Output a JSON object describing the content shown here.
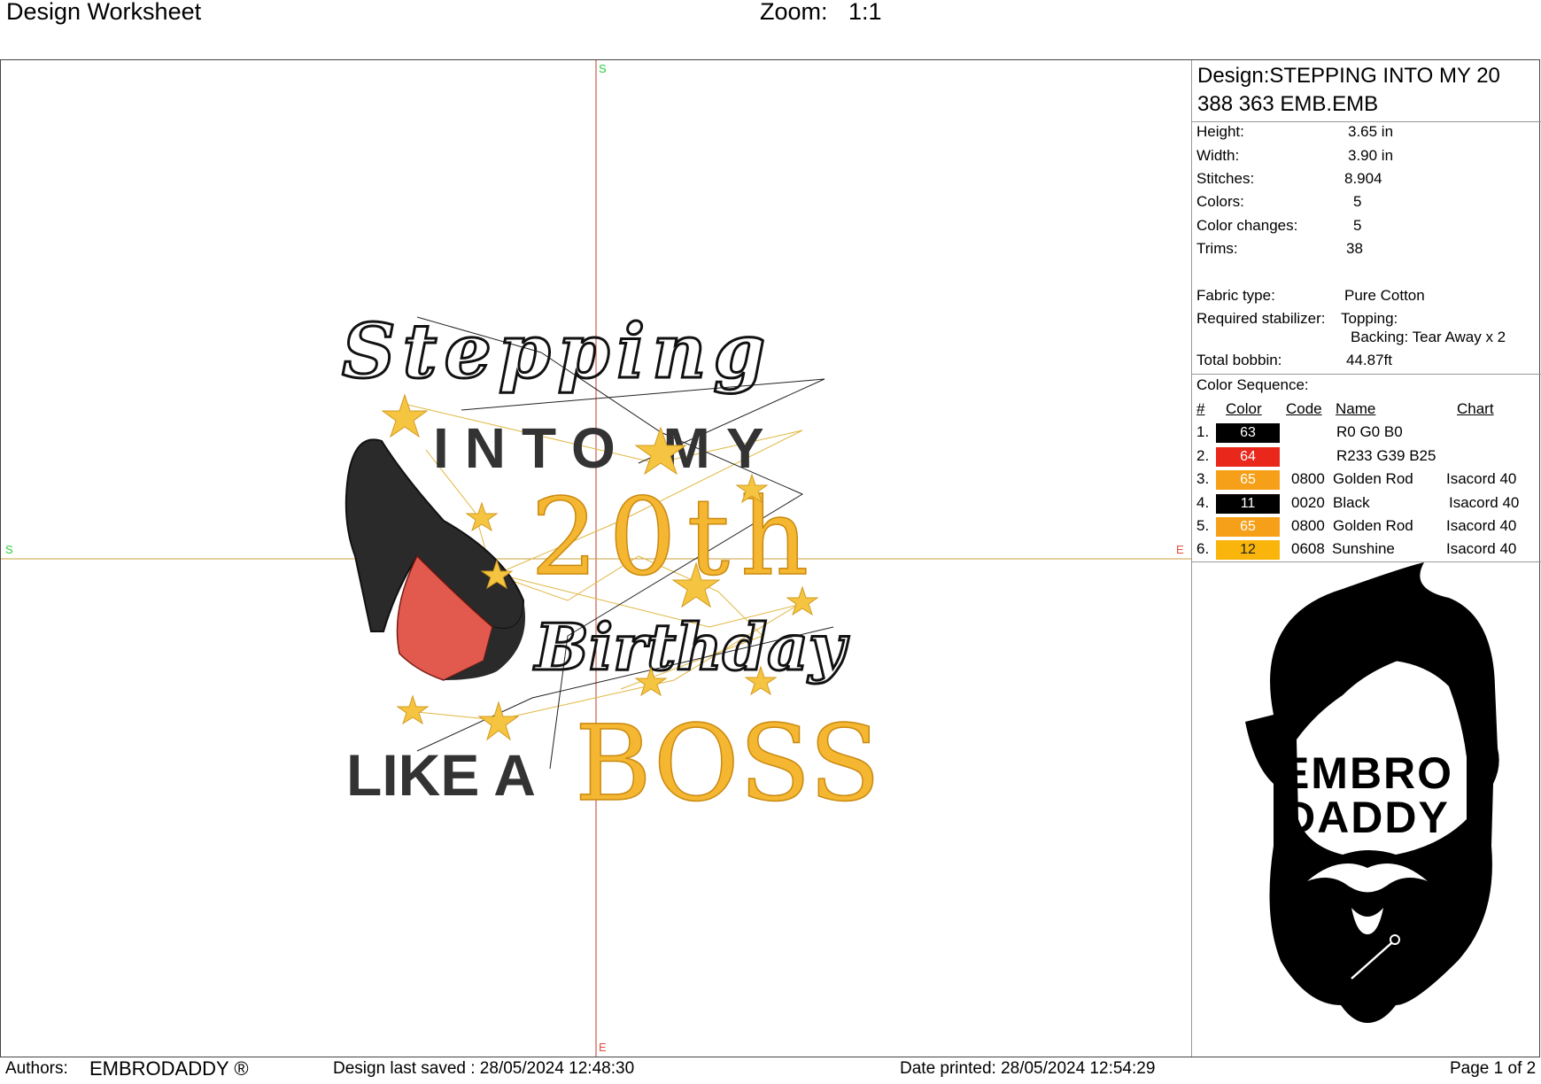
{
  "header": {
    "title": "Design Worksheet",
    "zoom_label": "Zoom:",
    "zoom_value": "1:1"
  },
  "canvas": {
    "markers": {
      "top": "S",
      "left": "S",
      "right": "E",
      "bottom": "E"
    },
    "design_text": {
      "line1": "Stepping",
      "line2": "INTO MY",
      "line3": "20th",
      "line4": "Birthday",
      "line5a": "LIKE A",
      "line5b": "BOSS"
    },
    "colors": {
      "crosshair_v": "#c0392b",
      "crosshair_h": "#c8a040",
      "gold": "#f5b731",
      "red": "#e9271b",
      "black": "#111111"
    }
  },
  "panel": {
    "design_title": "Design:STEPPING INTO MY 20 388 363 EMB.EMB",
    "stats": [
      {
        "label": "Height:",
        "value": "3.65 in"
      },
      {
        "label": "Width:",
        "value": "3.90 in"
      },
      {
        "label": "Stitches:",
        "value": "8.904"
      },
      {
        "label": "Colors:",
        "value": "5"
      },
      {
        "label": "Color changes:",
        "value": "5"
      },
      {
        "label": "Trims:",
        "value": "38"
      }
    ],
    "fabric_label": "Fabric type:",
    "fabric_value": "Pure Cotton",
    "stabilizer_label": "Required stabilizer:",
    "topping": "Topping:",
    "backing": "Backing: Tear Away x 2",
    "bobbin_label": "Total bobbin:",
    "bobbin_value": "44.87ft",
    "sequence_title": "Color Sequence:",
    "headers": {
      "num": "#",
      "color": "Color",
      "code": "Code",
      "name": "Name",
      "chart": "Chart"
    },
    "sequence": [
      {
        "num": "1.",
        "swatch": "63",
        "hex": "#000000",
        "code": "",
        "name": "R0 G0 B0",
        "chart": ""
      },
      {
        "num": "2.",
        "swatch": "64",
        "hex": "#e9271b",
        "code": "",
        "name": "R233 G39 B25",
        "chart": ""
      },
      {
        "num": "3.",
        "swatch": "65",
        "hex": "#f6a01a",
        "code": "0800",
        "name": "Golden Rod",
        "chart": "Isacord 40"
      },
      {
        "num": "4.",
        "swatch": "11",
        "hex": "#000000",
        "code": "0020",
        "name": "Black",
        "chart": "Isacord 40"
      },
      {
        "num": "5.",
        "swatch": "65",
        "hex": "#f6a01a",
        "code": "0800",
        "name": "Golden Rod",
        "chart": "Isacord 40"
      },
      {
        "num": "6.",
        "swatch": "12",
        "hex": "#f9b50c",
        "code": "0608",
        "name": "Sunshine",
        "chart": "Isacord 40"
      }
    ],
    "logo": {
      "line1": "EMBRO",
      "line2": "DADDY"
    }
  },
  "footer": {
    "authors_label": "Authors:",
    "authors_value": "EMBRODADDY ®",
    "saved": "Design last saved : 28/05/2024 12:48:30",
    "printed": "Date printed: 28/05/2024 12:54:29",
    "page": "Page 1 of 2"
  }
}
